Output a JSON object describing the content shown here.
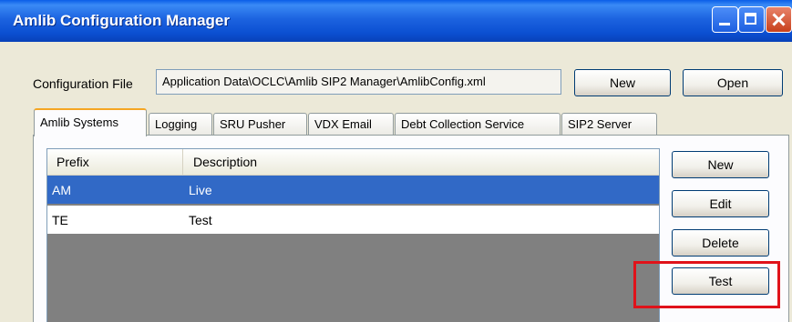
{
  "window": {
    "title": "Amlib Configuration Manager"
  },
  "config": {
    "label": "Configuration File",
    "path": "Application Data\\OCLC\\Amlib SIP2 Manager\\AmlibConfig.xml",
    "new_label": "New",
    "open_label": "Open"
  },
  "tabs": [
    {
      "label": "Amlib Systems",
      "active": true
    },
    {
      "label": "Logging",
      "active": false
    },
    {
      "label": "SRU Pusher",
      "active": false
    },
    {
      "label": "VDX Email",
      "active": false
    },
    {
      "label": "Debt Collection Service",
      "active": false
    },
    {
      "label": "SIP2 Server",
      "active": false
    }
  ],
  "systems_list": {
    "columns": [
      "Prefix",
      "Description"
    ],
    "rows": [
      {
        "prefix": "AM",
        "description": "Live",
        "selected": true
      },
      {
        "prefix": "TE",
        "description": "Test",
        "selected": false
      }
    ]
  },
  "side_buttons": {
    "new_label": "New",
    "edit_label": "Edit",
    "delete_label": "Delete",
    "test_label": "Test"
  },
  "colors": {
    "titlebar": "#0b4fd1",
    "selection": "#3169c6",
    "highlight": "#e0121a",
    "active_tab_accent": "#f5a623"
  }
}
